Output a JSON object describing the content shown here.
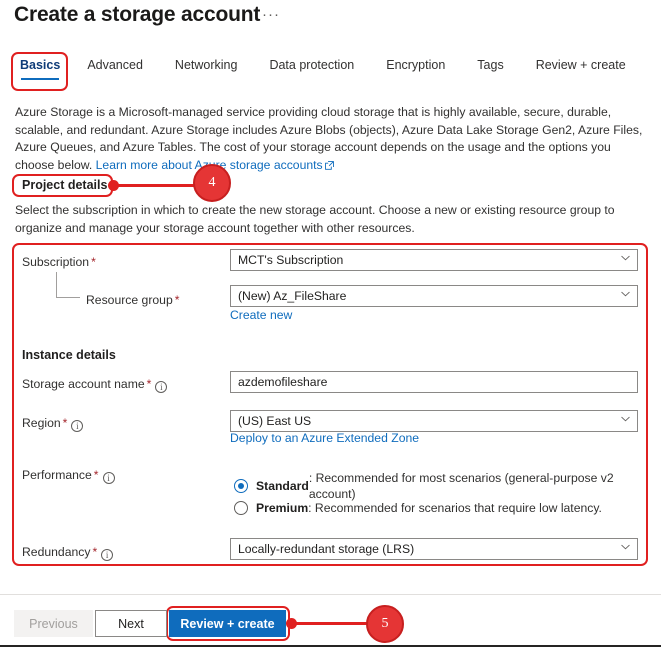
{
  "header": {
    "title": "Create a storage account",
    "more_menu": "···"
  },
  "tabs": [
    {
      "label": "Basics",
      "active": true
    },
    {
      "label": "Advanced",
      "active": false
    },
    {
      "label": "Networking",
      "active": false
    },
    {
      "label": "Data protection",
      "active": false
    },
    {
      "label": "Encryption",
      "active": false
    },
    {
      "label": "Tags",
      "active": false
    },
    {
      "label": "Review + create",
      "active": false
    }
  ],
  "description": {
    "text": "Azure Storage is a Microsoft-managed service providing cloud storage that is highly available, secure, durable, scalable, and redundant. Azure Storage includes Azure Blobs (objects), Azure Data Lake Storage Gen2, Azure Files, Azure Queues, and Azure Tables. The cost of your storage account depends on the usage and the options you choose below. ",
    "link_text": "Learn more about Azure storage accounts"
  },
  "project_details": {
    "heading": "Project details",
    "subtext": "Select the subscription in which to create the new storage account. Choose a new or existing resource group to organize and manage your storage account together with other resources.",
    "subscription": {
      "label": "Subscription",
      "required": "*",
      "value": "MCT's Subscription"
    },
    "resource_group": {
      "label": "Resource group",
      "required": "*",
      "value": "(New) Az_FileShare",
      "create_new_link": "Create new"
    }
  },
  "instance_details": {
    "heading": "Instance details",
    "storage_account_name": {
      "label": "Storage account name",
      "required": "*",
      "value": "azdemofileshare"
    },
    "region": {
      "label": "Region",
      "required": "*",
      "value": "(US) East US",
      "extended_zone_link": "Deploy to an Azure Extended Zone"
    },
    "performance": {
      "label": "Performance",
      "required": "*",
      "options": [
        {
          "name": "Standard",
          "description": ": Recommended for most scenarios (general-purpose v2 account)",
          "selected": true
        },
        {
          "name": "Premium",
          "description": ": Recommended for scenarios that require low latency.",
          "selected": false
        }
      ]
    },
    "redundancy": {
      "label": "Redundancy",
      "required": "*",
      "value": "Locally-redundant storage (LRS)"
    }
  },
  "footer": {
    "previous": "Previous",
    "next": "Next",
    "review_create": "Review + create"
  },
  "annotations": {
    "callout_4": "4",
    "callout_5": "5",
    "accent_color": "#e02020"
  }
}
